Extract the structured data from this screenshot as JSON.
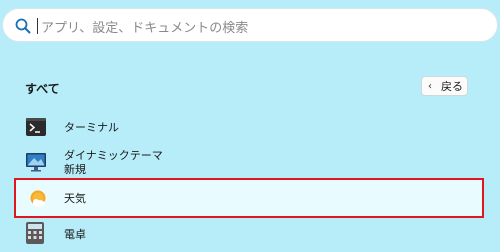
{
  "search": {
    "placeholder": "アプリ、設定、ドキュメントの検索"
  },
  "section": {
    "title": "すべて",
    "back_label": "戻る"
  },
  "apps": [
    {
      "label": "ターミナル",
      "icon": "terminal-icon"
    },
    {
      "label_line1": "ダイナミックテーマ",
      "label_line2": "新規",
      "icon": "dynamic-theme-icon"
    },
    {
      "label": "天気",
      "icon": "weather-icon",
      "selected": true
    },
    {
      "label": "電卓",
      "icon": "calculator-icon"
    }
  ],
  "colors": {
    "background": "#b7ecf9",
    "highlight_border": "#e0171f",
    "selected_bg": "#e8fbfe"
  }
}
